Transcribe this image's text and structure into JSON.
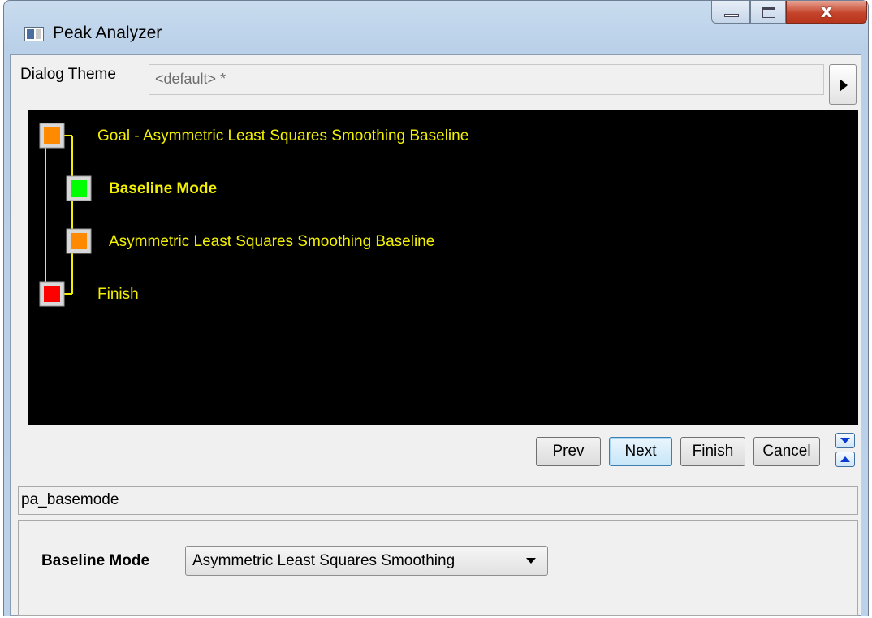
{
  "window": {
    "title": "Peak Analyzer"
  },
  "theme": {
    "label": "Dialog Theme",
    "value": "<default> *"
  },
  "flow": {
    "nodes": [
      {
        "label": "Goal - Asymmetric Least Squares Smoothing Baseline",
        "status": "orange",
        "current": false
      },
      {
        "label": "Baseline Mode",
        "status": "green",
        "current": true
      },
      {
        "label": "Asymmetric Least Squares Smoothing Baseline",
        "status": "orange",
        "current": false
      },
      {
        "label": "Finish",
        "status": "red",
        "current": false
      }
    ],
    "colors": {
      "background": "#000000",
      "line": "#f2f000",
      "orange": "#ff8a00",
      "green": "#00ff00",
      "red": "#ff0000"
    }
  },
  "nav": {
    "prev": "Prev",
    "next": "Next",
    "finish": "Finish",
    "cancel": "Cancel"
  },
  "status_text": "pa_basemode",
  "settings": {
    "baseline_mode_label": "Baseline Mode",
    "baseline_mode_value": "Asymmetric Least Squares Smoothing"
  }
}
